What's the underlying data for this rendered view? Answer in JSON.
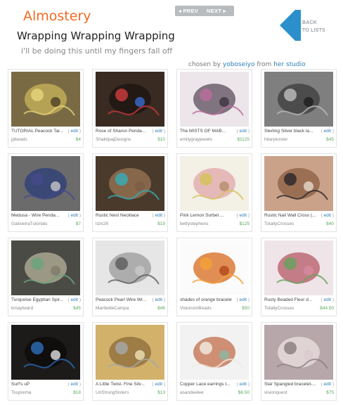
{
  "header": {
    "brand": "Almostery",
    "list_title": "Wrapping Wrapping Wrapping",
    "list_description": "i'll be doing this until my fingers fall off"
  },
  "nav": {
    "prev_label": "PREV",
    "next_label": "NEXT"
  },
  "back": {
    "line1": "BACK",
    "line2": "TO LISTS"
  },
  "curator": {
    "prefix": "chosen by",
    "user": "yoboseiyo",
    "middle": "from",
    "studio": "her studio"
  },
  "colors": {
    "brand": "#f26a21",
    "link": "#2c7fb8",
    "price": "#5aa85a",
    "back_arrow": "#2b8fcb"
  },
  "items": [
    {
      "title": "TUTORIAL Peacock Tai...",
      "shop": "jpbeads",
      "price": "$4",
      "edit": "edit"
    },
    {
      "title": "Rose of Sharon Penda...",
      "shop": "ShaktipajDesigns",
      "price": "$10",
      "edit": "edit"
    },
    {
      "title": "The MISTS OF MAB...",
      "shop": "emilygrayjewels",
      "price": "$1125",
      "edit": "edit"
    },
    {
      "title": "Sterling Silver black la...",
      "shop": "hilarykoster",
      "price": "$45",
      "edit": "edit"
    },
    {
      "title": "Medusa - Wire Penda...",
      "shop": "GailswiraTutorials",
      "price": "$7",
      "edit": "edit"
    },
    {
      "title": "Rustic Nest Necklace",
      "shop": "lizix26",
      "price": "$19",
      "edit": "edit"
    },
    {
      "title": "Pink Lemon Sorbet ...",
      "shop": "bettystephens",
      "price": "$125",
      "edit": "edit"
    },
    {
      "title": "Rustic Nail Wall Cross (...",
      "shop": "TotallyCrosses",
      "price": "$40",
      "edit": "edit"
    },
    {
      "title": "Turquoise Egyptian Spir...",
      "shop": "kmaylward",
      "price": "$45",
      "edit": "edit"
    },
    {
      "title": "Peacock Pearl Wire Wr...",
      "shop": "MaribelleCampa",
      "price": "$46",
      "edit": "edit"
    },
    {
      "title": "shades of orange bracelet",
      "shop": "VisionsInBeads",
      "price": "$50",
      "edit": "edit"
    },
    {
      "title": "Rusty Beaded Fleur d...",
      "shop": "TotallyCrosses",
      "price": "$44.50",
      "edit": "edit"
    },
    {
      "title": "Surf's uP",
      "shop": "Tsuprema",
      "price": "$18",
      "edit": "edit"
    },
    {
      "title": "A Little Twist- Fine Silv...",
      "shop": "UnStrungSisters",
      "price": "$13",
      "edit": "edit"
    },
    {
      "title": "Copper Lace earrings t...",
      "shop": "asandeelee",
      "price": "$6.50",
      "edit": "edit"
    },
    {
      "title": "Star Spangled bracelet-...",
      "shop": "visionquest",
      "price": "$75",
      "edit": "edit"
    }
  ]
}
